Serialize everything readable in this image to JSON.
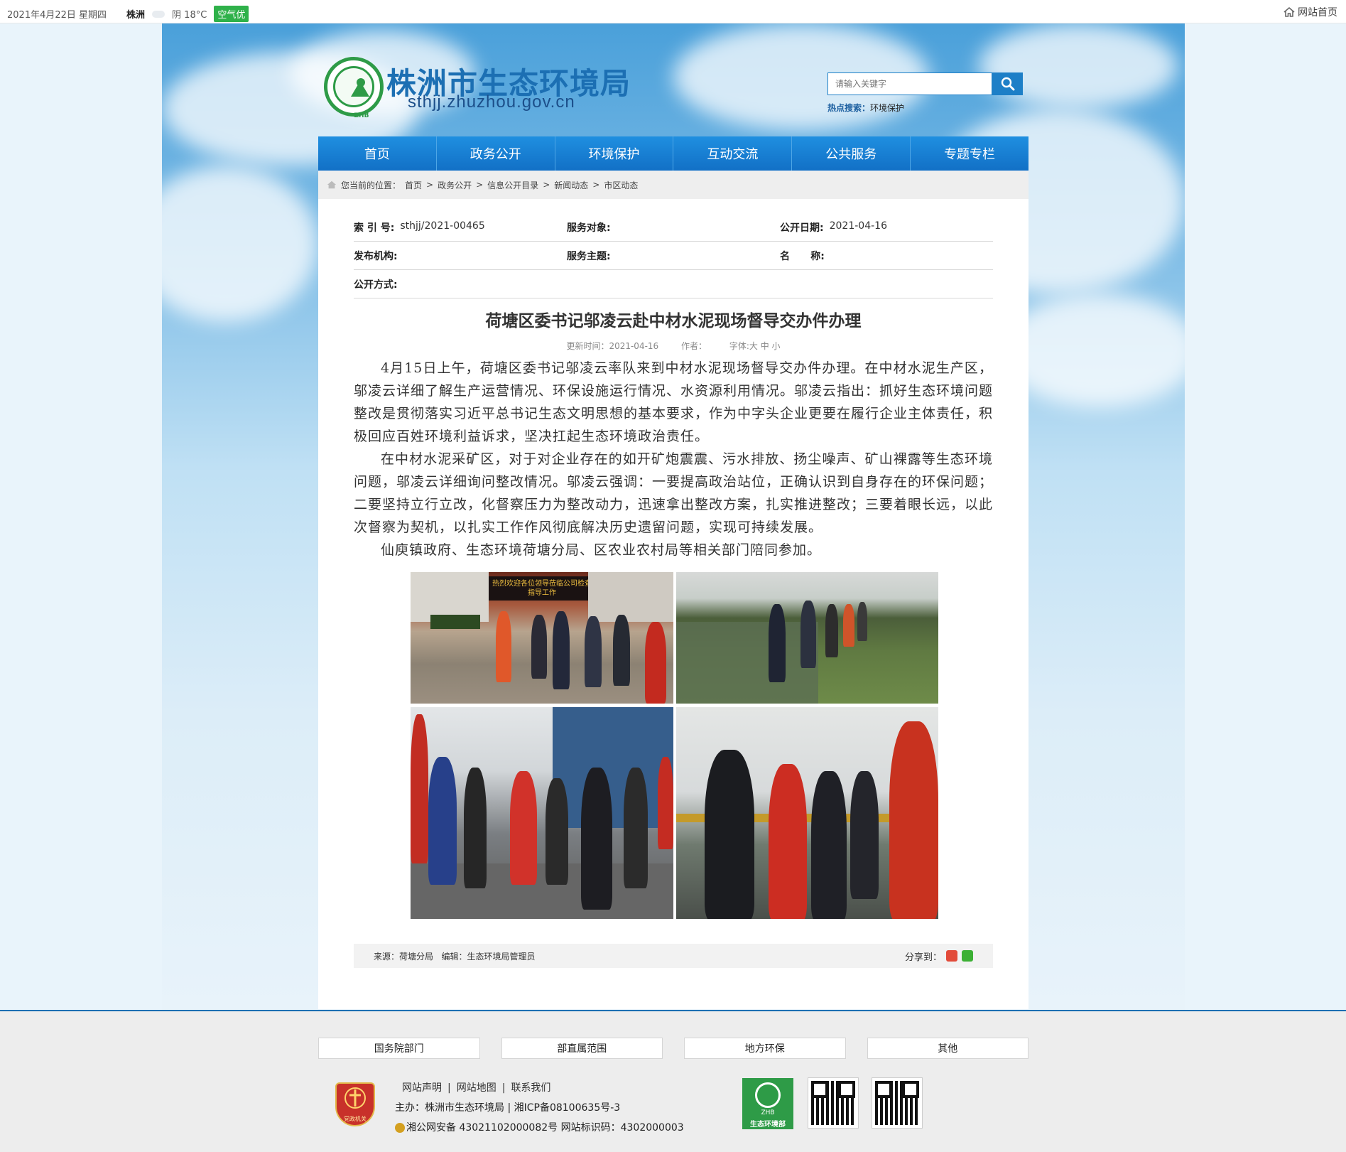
{
  "topbar": {
    "date": "2021年4月22日 星期四",
    "city": "株洲",
    "weather": "阴 18°C",
    "air_quality": "空气优",
    "home_link": "网站首页"
  },
  "header": {
    "site_title": "株洲市生态环境局",
    "site_domain": "sthjj.zhuzhou.gov.cn",
    "logo_text": "ZHB",
    "search_placeholder": "请输入关键字",
    "hot_label": "热点搜索：",
    "hot_keyword": "环境保护"
  },
  "nav": {
    "items": [
      "首页",
      "政务公开",
      "环境保护",
      "互动交流",
      "公共服务",
      "专题专栏"
    ]
  },
  "breadcrumb": {
    "prefix": "您当前的位置：",
    "items": [
      "首页",
      "政务公开",
      "信息公开目录",
      "新闻动态",
      "市区动态"
    ],
    "separator": ">"
  },
  "meta": {
    "index_label": "索  引 号:",
    "index_value": "sthjj/2021-00465",
    "target_label": "服务对象:",
    "target_value": "",
    "date_label": "公开日期:",
    "date_value": "2021-04-16",
    "org_label": "发布机构:",
    "org_value": "",
    "topic_label": "服务主题:",
    "topic_value": "",
    "name_label": "名      称:",
    "name_value": "",
    "method_label": "公开方式:",
    "method_value": ""
  },
  "article": {
    "title": "荷塘区委书记邬凌云赴中材水泥现场督导交办件办理",
    "update_label": "更新时间：2021-04-16",
    "author_label": "作者：",
    "font_label": "字体:大 中 小",
    "paragraphs": [
      "4月15日上午，荷塘区委书记邬凌云率队来到中材水泥现场督导交办件办理。在中材水泥生产区，邬凌云详细了解生产运营情况、环保设施运行情况、水资源利用情况。邬凌云指出：抓好生态环境问题整改是贯彻落实习近平总书记生态文明思想的基本要求，作为中字头企业更要在履行企业主体责任，积极回应百姓环境利益诉求，坚决扛起生态环境政治责任。",
      "在中材水泥采矿区，对于对企业存在的如开矿炮震震、污水排放、扬尘噪声、矿山裸露等生态环境问题，邬凌云详细询问整改情况。邬凌云强调：一要提高政治站位，正确认识到自身存在的环保问题；二要坚持立行立改，化督察压力为整改动力，迅速拿出整改方案，扎实推进整改；三要着眼长远，以此次督察为契机，以扎实工作作风彻底解决历史遗留问题，实现可持续发展。",
      "仙庾镇政府、生态环境荷塘分局、区农业农村局等相关部门陪同参加。"
    ],
    "banner_text": "热烈欢迎各位领导莅临公司检查指导工作",
    "source_text": "来源：荷塘分局   编辑：生态环境局管理员",
    "share_label": "分享到："
  },
  "footer": {
    "links": [
      "国务院部门",
      "部直属范围",
      "地方环保",
      "其他"
    ],
    "nav_links": [
      "网站声明",
      "网站地图",
      "联系我们"
    ],
    "host": "主办：株洲市生态环境局 | 湘ICP备08100635号-3",
    "police": "湘公网安备 43021102000082号 网站标识码：4302000003",
    "gov_badge_text": "党政机关",
    "logo_line1": "ZHB",
    "logo_line2": "生态环境部"
  },
  "colors": {
    "nav_blue": "#1270c6",
    "title_blue": "#1c6fb3",
    "logo_green": "#2e9b47",
    "air_green": "#2fb14a"
  }
}
